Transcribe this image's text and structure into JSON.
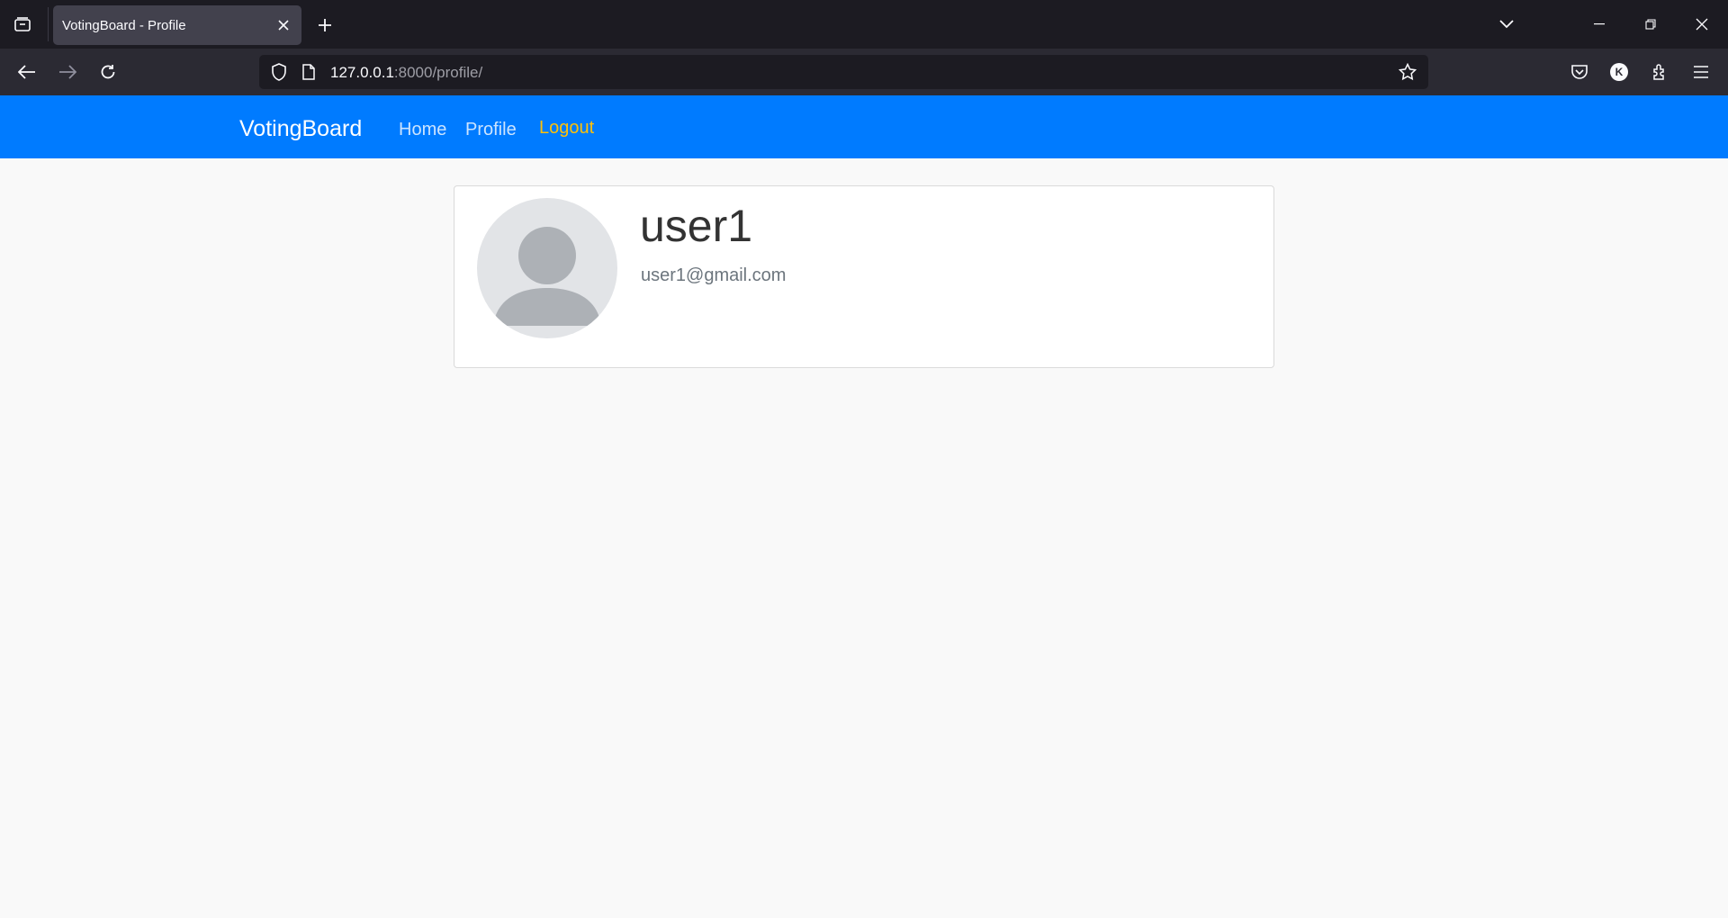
{
  "browser": {
    "tab_title": "VotingBoard - Profile",
    "url_host": "127.0.0.1",
    "url_path": ":8000/profile/",
    "account_initial": "K"
  },
  "site": {
    "brand": "VotingBoard",
    "nav": {
      "home": "Home",
      "profile": "Profile",
      "logout": "Logout"
    }
  },
  "profile": {
    "username": "user1",
    "email": "user1@gmail.com"
  },
  "colors": {
    "navbar": "#007bff",
    "logout": "#ffc107"
  }
}
